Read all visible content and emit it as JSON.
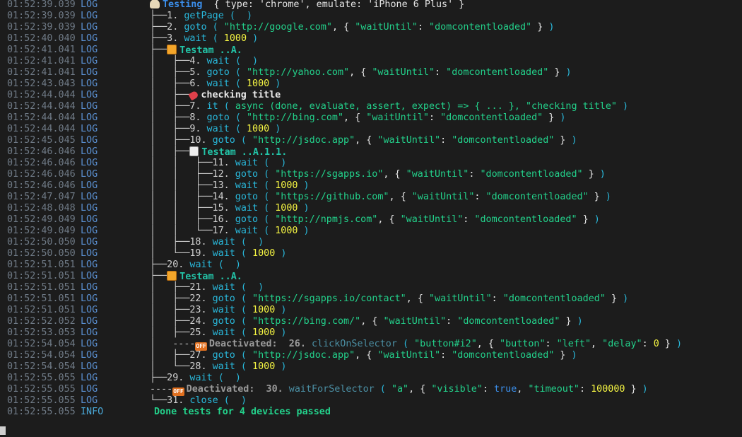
{
  "window": {
    "background": "#1c1c1c"
  },
  "lines": [
    {
      "ts": "01:52:39.039",
      "lvl": "LOG",
      "tree": "",
      "depth": 0,
      "kind": "desc",
      "icon": "shell-icon",
      "color": "blue",
      "text": "Testing",
      "extra": "  { type: 'chrome', emulate: 'iPhone 6 Plus' }"
    },
    {
      "ts": "01:52:39.039",
      "lvl": "LOG",
      "tree": "├──",
      "depth": 0,
      "kind": "step",
      "num": "1.",
      "fn": "getPage",
      "args": []
    },
    {
      "ts": "01:52:39.039",
      "lvl": "LOG",
      "tree": "├──",
      "depth": 0,
      "kind": "step",
      "num": "2.",
      "fn": "goto",
      "args": [
        [
          "str",
          "\"http://google.com\""
        ],
        [
          "plain",
          ", { "
        ],
        [
          "str",
          "\"waitUntil\""
        ],
        [
          "plain",
          ": "
        ],
        [
          "str",
          "\"domcontentloaded\""
        ],
        [
          "plain",
          " }"
        ]
      ]
    },
    {
      "ts": "01:52:40.040",
      "lvl": "LOG",
      "tree": "├──",
      "depth": 0,
      "kind": "step",
      "num": "3.",
      "fn": "wait",
      "args": [
        [
          "numv",
          "1000"
        ]
      ]
    },
    {
      "ts": "01:52:41.041",
      "lvl": "LOG",
      "tree": "├──",
      "depth": 0,
      "kind": "desc",
      "icon": "book-icon",
      "color": "teal",
      "text": "Testam ..A."
    },
    {
      "ts": "01:52:41.041",
      "lvl": "LOG",
      "tree": "│   ├──",
      "depth": 1,
      "kind": "step",
      "num": "4.",
      "fn": "wait",
      "args": []
    },
    {
      "ts": "01:52:41.041",
      "lvl": "LOG",
      "tree": "│   ├──",
      "depth": 1,
      "kind": "step",
      "num": "5.",
      "fn": "goto",
      "args": [
        [
          "str",
          "\"http://yahoo.com\""
        ],
        [
          "plain",
          ", { "
        ],
        [
          "str",
          "\"waitUntil\""
        ],
        [
          "plain",
          ": "
        ],
        [
          "str",
          "\"domcontentloaded\""
        ],
        [
          "plain",
          " }"
        ]
      ]
    },
    {
      "ts": "01:52:43.043",
      "lvl": "LOG",
      "tree": "│   ├──",
      "depth": 1,
      "kind": "step",
      "num": "6.",
      "fn": "wait",
      "args": [
        [
          "numv",
          "1000"
        ]
      ]
    },
    {
      "ts": "01:52:44.044",
      "lvl": "LOG",
      "tree": "│   ├──",
      "depth": 1,
      "kind": "desc",
      "icon": "tag-icon",
      "color": "plain",
      "text": "checking title"
    },
    {
      "ts": "01:52:44.044",
      "lvl": "LOG",
      "tree": "│   ├──",
      "depth": 1,
      "kind": "step",
      "num": "7.",
      "fn": "it",
      "args": [
        [
          "str",
          "async (done, evaluate, assert, expect) => { ... }, \"checking title\""
        ]
      ]
    },
    {
      "ts": "01:52:44.044",
      "lvl": "LOG",
      "tree": "│   ├──",
      "depth": 1,
      "kind": "step",
      "num": "8.",
      "fn": "goto",
      "args": [
        [
          "str",
          "\"http://bing.com\""
        ],
        [
          "plain",
          ", { "
        ],
        [
          "str",
          "\"waitUntil\""
        ],
        [
          "plain",
          ": "
        ],
        [
          "str",
          "\"domcontentloaded\""
        ],
        [
          "plain",
          " }"
        ]
      ]
    },
    {
      "ts": "01:52:44.044",
      "lvl": "LOG",
      "tree": "│   ├──",
      "depth": 1,
      "kind": "step",
      "num": "9.",
      "fn": "wait",
      "args": [
        [
          "numv",
          "1000"
        ]
      ]
    },
    {
      "ts": "01:52:45.045",
      "lvl": "LOG",
      "tree": "│   ├──",
      "depth": 1,
      "kind": "step",
      "num": "10.",
      "fn": "goto",
      "args": [
        [
          "str",
          "\"http://jsdoc.app\""
        ],
        [
          "plain",
          ", { "
        ],
        [
          "str",
          "\"waitUntil\""
        ],
        [
          "plain",
          ": "
        ],
        [
          "str",
          "\"domcontentloaded\""
        ],
        [
          "plain",
          " }"
        ]
      ]
    },
    {
      "ts": "01:52:46.046",
      "lvl": "LOG",
      "tree": "│   ├──",
      "depth": 1,
      "kind": "desc",
      "icon": "memo-icon",
      "color": "teal",
      "text": "Testam ..A.1.1."
    },
    {
      "ts": "01:52:46.046",
      "lvl": "LOG",
      "tree": "│   │   ├──",
      "depth": 2,
      "kind": "step",
      "num": "11.",
      "fn": "wait",
      "args": []
    },
    {
      "ts": "01:52:46.046",
      "lvl": "LOG",
      "tree": "│   │   ├──",
      "depth": 2,
      "kind": "step",
      "num": "12.",
      "fn": "goto",
      "args": [
        [
          "str",
          "\"https://sgapps.io\""
        ],
        [
          "plain",
          ", { "
        ],
        [
          "str",
          "\"waitUntil\""
        ],
        [
          "plain",
          ": "
        ],
        [
          "str",
          "\"domcontentloaded\""
        ],
        [
          "plain",
          " }"
        ]
      ]
    },
    {
      "ts": "01:52:46.046",
      "lvl": "LOG",
      "tree": "│   │   ├──",
      "depth": 2,
      "kind": "step",
      "num": "13.",
      "fn": "wait",
      "args": [
        [
          "numv",
          "1000"
        ]
      ]
    },
    {
      "ts": "01:52:47.047",
      "lvl": "LOG",
      "tree": "│   │   ├──",
      "depth": 2,
      "kind": "step",
      "num": "14.",
      "fn": "goto",
      "args": [
        [
          "str",
          "\"https://github.com\""
        ],
        [
          "plain",
          ", { "
        ],
        [
          "str",
          "\"waitUntil\""
        ],
        [
          "plain",
          ": "
        ],
        [
          "str",
          "\"domcontentloaded\""
        ],
        [
          "plain",
          " }"
        ]
      ]
    },
    {
      "ts": "01:52:48.048",
      "lvl": "LOG",
      "tree": "│   │   ├──",
      "depth": 2,
      "kind": "step",
      "num": "15.",
      "fn": "wait",
      "args": [
        [
          "numv",
          "1000"
        ]
      ]
    },
    {
      "ts": "01:52:49.049",
      "lvl": "LOG",
      "tree": "│   │   ├──",
      "depth": 2,
      "kind": "step",
      "num": "16.",
      "fn": "goto",
      "args": [
        [
          "str",
          "\"http://npmjs.com\""
        ],
        [
          "plain",
          ", { "
        ],
        [
          "str",
          "\"waitUntil\""
        ],
        [
          "plain",
          ": "
        ],
        [
          "str",
          "\"domcontentloaded\""
        ],
        [
          "plain",
          " }"
        ]
      ]
    },
    {
      "ts": "01:52:49.049",
      "lvl": "LOG",
      "tree": "│   │   └──",
      "depth": 2,
      "kind": "step",
      "num": "17.",
      "fn": "wait",
      "args": [
        [
          "numv",
          "1000"
        ]
      ]
    },
    {
      "ts": "01:52:50.050",
      "lvl": "LOG",
      "tree": "│   ├──",
      "depth": 1,
      "kind": "step",
      "num": "18.",
      "fn": "wait",
      "args": []
    },
    {
      "ts": "01:52:50.050",
      "lvl": "LOG",
      "tree": "│   └──",
      "depth": 1,
      "kind": "step",
      "num": "19.",
      "fn": "wait",
      "args": [
        [
          "numv",
          "1000"
        ]
      ]
    },
    {
      "ts": "01:52:51.051",
      "lvl": "LOG",
      "tree": "├──",
      "depth": 0,
      "kind": "step",
      "num": "20.",
      "fn": "wait",
      "args": []
    },
    {
      "ts": "01:52:51.051",
      "lvl": "LOG",
      "tree": "├──",
      "depth": 0,
      "kind": "desc",
      "icon": "book-icon",
      "color": "teal",
      "text": "Testam ..A."
    },
    {
      "ts": "01:52:51.051",
      "lvl": "LOG",
      "tree": "│   ├──",
      "depth": 1,
      "kind": "step",
      "num": "21.",
      "fn": "wait",
      "args": []
    },
    {
      "ts": "01:52:51.051",
      "lvl": "LOG",
      "tree": "│   ├──",
      "depth": 1,
      "kind": "step",
      "num": "22.",
      "fn": "goto",
      "args": [
        [
          "str",
          "\"https://sgapps.io/contact\""
        ],
        [
          "plain",
          ", { "
        ],
        [
          "str",
          "\"waitUntil\""
        ],
        [
          "plain",
          ": "
        ],
        [
          "str",
          "\"domcontentloaded\""
        ],
        [
          "plain",
          " }"
        ]
      ]
    },
    {
      "ts": "01:52:51.051",
      "lvl": "LOG",
      "tree": "│   ├──",
      "depth": 1,
      "kind": "step",
      "num": "23.",
      "fn": "wait",
      "args": [
        [
          "numv",
          "1000"
        ]
      ]
    },
    {
      "ts": "01:52:52.052",
      "lvl": "LOG",
      "tree": "│   ├──",
      "depth": 1,
      "kind": "step",
      "num": "24.",
      "fn": "goto",
      "args": [
        [
          "str",
          "\"https://bing.com/\""
        ],
        [
          "plain",
          ", { "
        ],
        [
          "str",
          "\"waitUntil\""
        ],
        [
          "plain",
          ": "
        ],
        [
          "str",
          "\"domcontentloaded\""
        ],
        [
          "plain",
          " }"
        ]
      ]
    },
    {
      "ts": "01:52:53.053",
      "lvl": "LOG",
      "tree": "│   ├──",
      "depth": 1,
      "kind": "step",
      "num": "25.",
      "fn": "wait",
      "args": [
        [
          "numv",
          "1000"
        ]
      ]
    },
    {
      "ts": "01:52:54.054",
      "lvl": "LOG",
      "tree": "│   ----",
      "depth": 1,
      "kind": "deact",
      "label": "Deactivated:",
      "num": "26.",
      "fn": "clickOnSelector",
      "args": [
        [
          "str",
          "\"button#i2\""
        ],
        [
          "plain",
          ", { "
        ],
        [
          "str",
          "\"button\""
        ],
        [
          "plain",
          ": "
        ],
        [
          "str",
          "\"left\""
        ],
        [
          "plain",
          ", "
        ],
        [
          "str",
          "\"delay\""
        ],
        [
          "plain",
          ": "
        ],
        [
          "numv",
          "0"
        ],
        [
          "plain",
          " }"
        ]
      ]
    },
    {
      "ts": "01:52:54.054",
      "lvl": "LOG",
      "tree": "│   ├──",
      "depth": 1,
      "kind": "step",
      "num": "27.",
      "fn": "goto",
      "args": [
        [
          "str",
          "\"http://jsdoc.app\""
        ],
        [
          "plain",
          ", { "
        ],
        [
          "str",
          "\"waitUntil\""
        ],
        [
          "plain",
          ": "
        ],
        [
          "str",
          "\"domcontentloaded\""
        ],
        [
          "plain",
          " }"
        ]
      ]
    },
    {
      "ts": "01:52:54.054",
      "lvl": "LOG",
      "tree": "│   └──",
      "depth": 1,
      "kind": "step",
      "num": "28.",
      "fn": "wait",
      "args": [
        [
          "numv",
          "1000"
        ]
      ]
    },
    {
      "ts": "01:52:55.055",
      "lvl": "LOG",
      "tree": "├──",
      "depth": 0,
      "kind": "step",
      "num": "29.",
      "fn": "wait",
      "args": []
    },
    {
      "ts": "01:52:55.055",
      "lvl": "LOG",
      "tree": "----",
      "depth": 0,
      "kind": "deact",
      "label": "Deactivated:",
      "num": "30.",
      "fn": "waitForSelector",
      "args": [
        [
          "str",
          "\"a\""
        ],
        [
          "plain",
          ", { "
        ],
        [
          "str",
          "\"visible\""
        ],
        [
          "plain",
          ": "
        ],
        [
          "kw",
          "true"
        ],
        [
          "plain",
          ", "
        ],
        [
          "str",
          "\"timeout\""
        ],
        [
          "plain",
          ": "
        ],
        [
          "numv",
          "100000"
        ],
        [
          "plain",
          " }"
        ]
      ]
    },
    {
      "ts": "01:52:55.055",
      "lvl": "LOG",
      "tree": "└──",
      "depth": 0,
      "kind": "step",
      "num": "31.",
      "fn": "close",
      "args": []
    },
    {
      "ts": "01:52:55.055",
      "lvl": "INFO",
      "tree": "",
      "depth": 0,
      "kind": "info",
      "text": "Done tests for 4 devices passed"
    }
  ],
  "off_badge": "OFF"
}
